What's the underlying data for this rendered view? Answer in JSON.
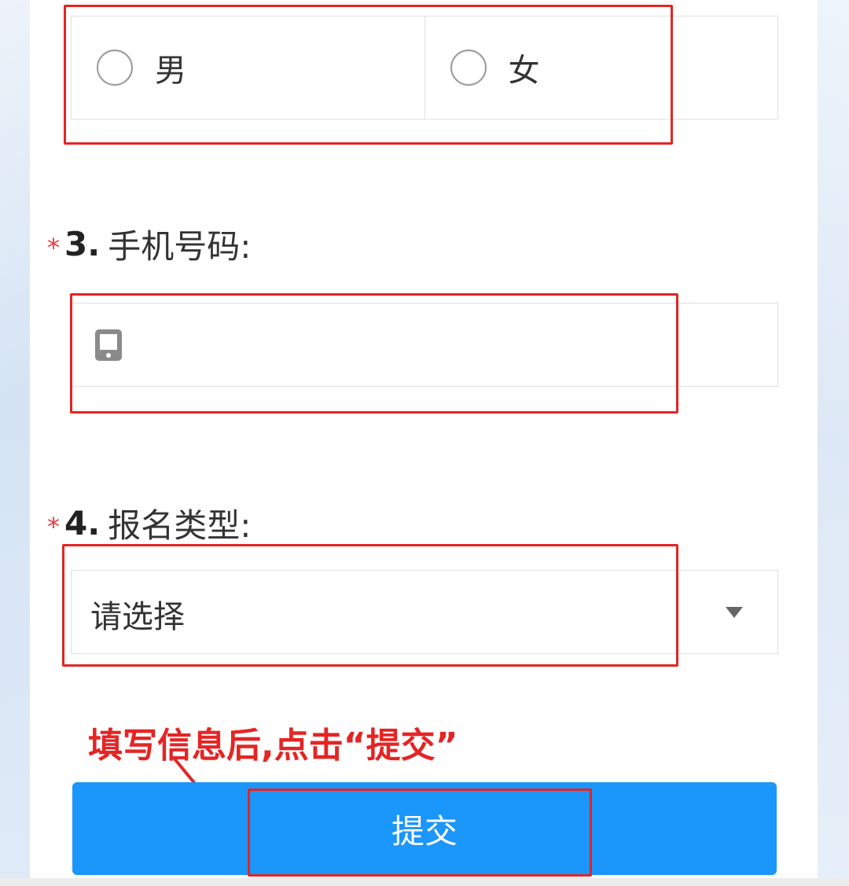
{
  "form": {
    "gender": {
      "options": [
        "男",
        "女"
      ]
    },
    "q3": {
      "star": "*",
      "number": "3.",
      "title": "手机号码:",
      "icon": "mobile-phone-icon",
      "value": ""
    },
    "q4": {
      "star": "*",
      "number": "4.",
      "title": "报名类型:",
      "placeholder": "请选择",
      "icon": "dropdown-triangle-icon"
    },
    "submit_label": "提交"
  },
  "annotation": {
    "instruction": "填写信息后,点击“提交”",
    "color": "#e52424"
  },
  "colors": {
    "accent": "#1b96fa",
    "required_star": "#e43d3d",
    "border": "#e0e0e0"
  }
}
